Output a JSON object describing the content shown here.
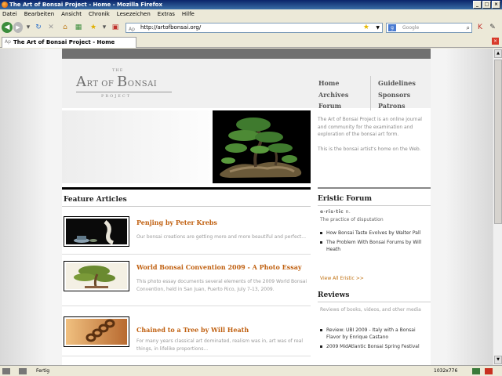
{
  "window": {
    "title": "The Art of Bonsai Project - Home - Mozilla Firefox"
  },
  "menu": [
    "Datei",
    "Bearbeiten",
    "Ansicht",
    "Chronik",
    "Lesezeichen",
    "Extras",
    "Hilfe"
  ],
  "address": {
    "url": "http://artofbonsai.org/"
  },
  "search": {
    "placeholder": "Google"
  },
  "tab": {
    "label": "The Art of Bonsai Project - Home"
  },
  "site": {
    "logo": {
      "the": "THE",
      "art": "A",
      "art_small": "RT OF ",
      "bonsai": "B",
      "bonsai_small": "ONSAI",
      "project": "PROJECT"
    },
    "nav_left": [
      "Home",
      "Archives",
      "Forum"
    ],
    "nav_right": [
      "Guidelines",
      "Sponsors",
      "Patrons"
    ],
    "blurb": [
      "The Art of Bonsai Project is an online journal and community for the examination and exploration of the bonsai art form.",
      "This is the bonsai artist's home on the Web."
    ],
    "feature_title": "Feature Articles",
    "articles": [
      {
        "title": "Penjing by Peter Krebs",
        "desc": "Our bonsai creations are getting more and more beautiful and perfect..."
      },
      {
        "title": "World Bonsai Convention 2009 - A Photo Essay",
        "desc": "This photo essay documents several elements of the 2009 World Bonsai Convention, held in San Juan, Puerto Rico, July 7-13, 2009."
      },
      {
        "title": "Chained to a Tree by Will Heath",
        "desc": "For many years classical art dominated, realism was in, art was of real things, in lifelike proportions..."
      }
    ],
    "eristic": {
      "title": "Eristic Forum",
      "word": "e·ris·tic",
      "pos": "n.",
      "definition": "The practice of disputation",
      "items": [
        "How Bonsai Taste Evolves by Walter Pall",
        "The Problem With Bonsai Forums by Will Heath"
      ],
      "view_all": "View All Eristic >>"
    },
    "reviews": {
      "title": "Reviews",
      "desc": "Reviews of books, videos, and other media",
      "items": [
        "Review: UBI 2009 - Italy with a Bonsai Flavor by Enrique Castano",
        "2009 MidAtlantic Bonsai Spring Festival"
      ]
    }
  },
  "status": {
    "text": "Fertig",
    "resolution": "1032x776"
  },
  "colors": {
    "accent": "#c06010",
    "link": "#c07010"
  }
}
